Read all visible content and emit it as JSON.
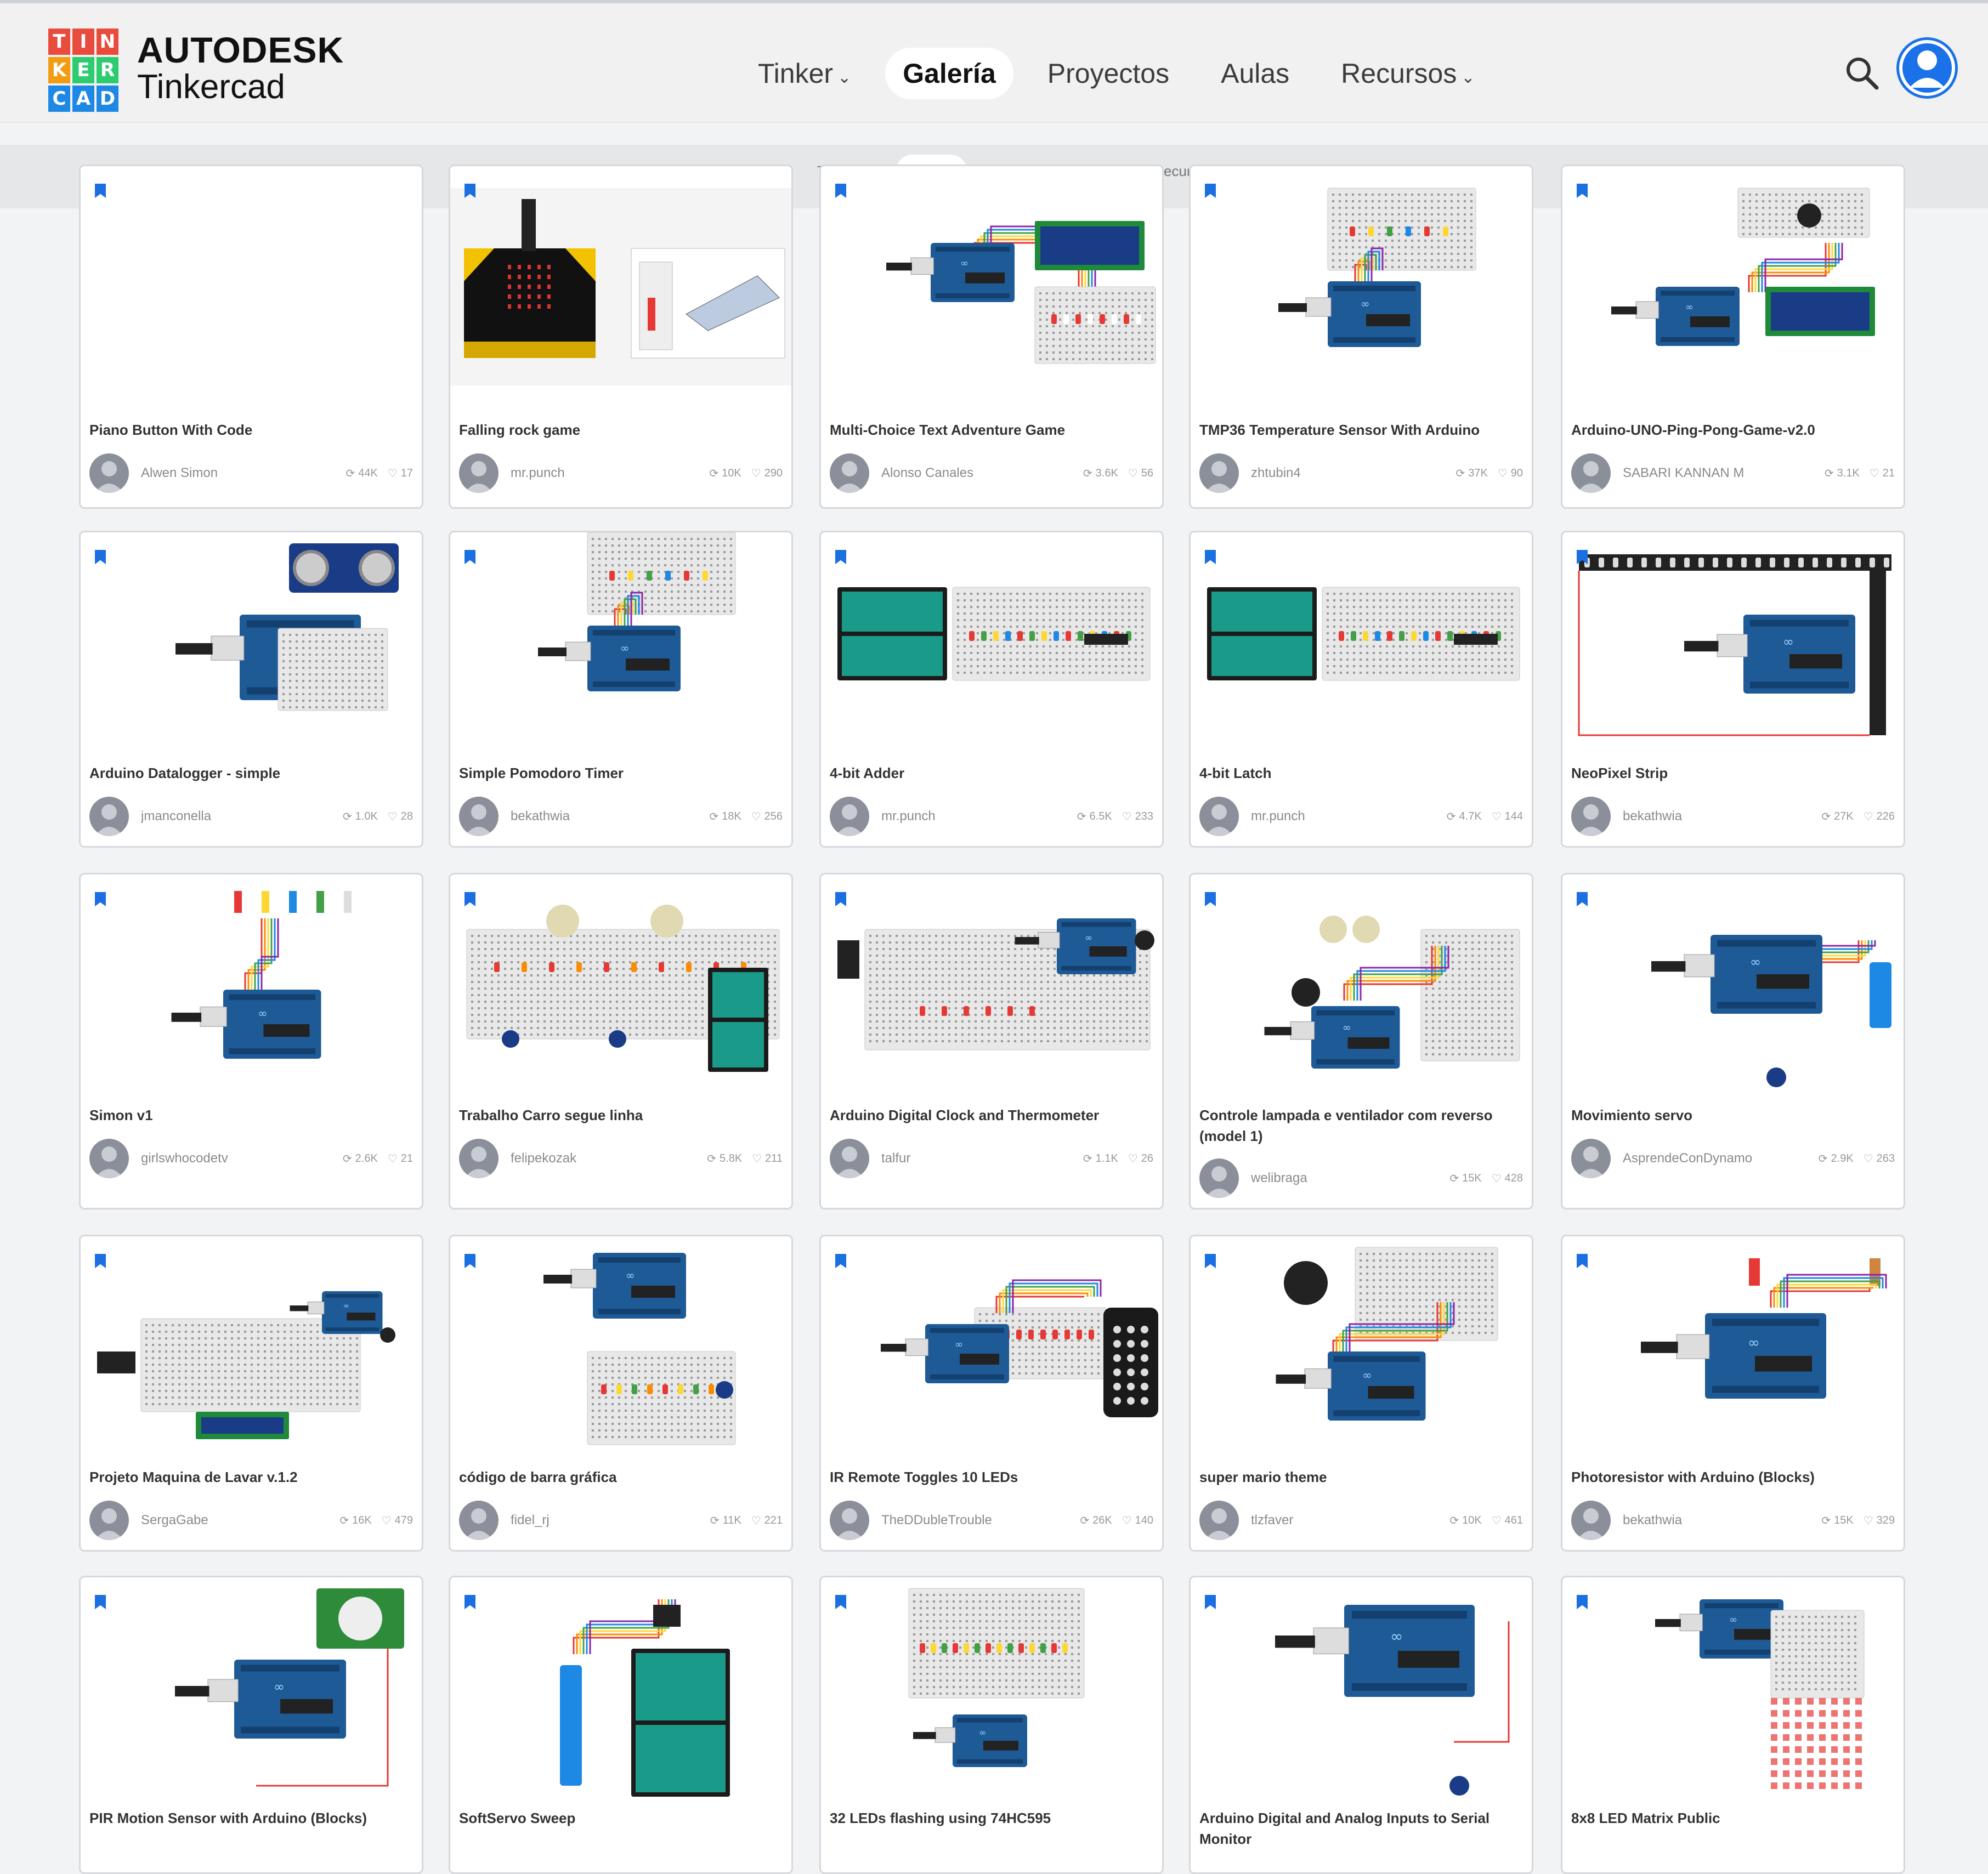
{
  "brand": {
    "logo_letters": [
      "T",
      "I",
      "N",
      "K",
      "E",
      "R",
      "C",
      "A",
      "D"
    ],
    "logo_colors": [
      "#e94b3c",
      "#e94b3c",
      "#e94b3c",
      "#f39c12",
      "#2ecc71",
      "#2ecc71",
      "#1e88e5",
      "#1e88e5",
      "#1e88e5"
    ],
    "line1": "AUTODESK",
    "line2": "Tinkercad"
  },
  "topnav": [
    {
      "label": "Tinker",
      "dropdown": true,
      "active": false
    },
    {
      "label": "Galería",
      "dropdown": false,
      "active": true
    },
    {
      "label": "Proyectos",
      "dropdown": false,
      "active": false
    },
    {
      "label": "Aulas",
      "dropdown": false,
      "active": false
    },
    {
      "label": "Recursos",
      "dropdown": true,
      "active": false
    }
  ],
  "subnav": [
    {
      "label": "Tinker",
      "dropdown": true,
      "active": false
    },
    {
      "label": "Galería",
      "dropdown": false,
      "active": true
    },
    {
      "label": "Proyectos",
      "dropdown": false,
      "active": false
    },
    {
      "label": "Aulas",
      "dropdown": false,
      "active": false
    },
    {
      "label": "Recursos",
      "dropdown": true,
      "active": false
    }
  ],
  "icons": {
    "search": "search-icon",
    "user": "user-avatar-icon",
    "bookmark": "bookmark-icon",
    "copy": "copy-icon",
    "like": "heart-icon"
  },
  "colors": {
    "accent": "#1b72e8",
    "arduino": "#1e5a96",
    "pcb_green": "#1f7a4d"
  },
  "cards": [
    {
      "title": "Piano Button With Code",
      "user": "Alwen Simon",
      "copies": "44K",
      "likes": "17",
      "thumb": "blank"
    },
    {
      "title": "Falling rock game",
      "user": "mr.punch",
      "copies": "10K",
      "likes": "290",
      "thumb": "microbit"
    },
    {
      "title": "Multi-Choice Text Adventure Game",
      "user": "Alonso Canales",
      "copies": "3.6K",
      "likes": "56",
      "thumb": "lcd"
    },
    {
      "title": "TMP36 Temperature Sensor With Arduino",
      "user": "zhtubin4",
      "copies": "37K",
      "likes": "90",
      "thumb": "breadboard-top"
    },
    {
      "title": "Arduino-UNO-Ping-Pong-Game-v2.0",
      "user": "SABARI KANNAN M",
      "copies": "3.1K",
      "likes": "21",
      "thumb": "lcd2"
    },
    {
      "title": "Arduino Datalogger - simple",
      "user": "jmanconella",
      "copies": "1.0K",
      "likes": "28",
      "thumb": "ultrasonic"
    },
    {
      "title": "Simple Pomodoro Timer",
      "user": "bekathwia",
      "copies": "18K",
      "likes": "256",
      "thumb": "breadboard-top"
    },
    {
      "title": "4-bit Adder",
      "user": "mr.punch",
      "copies": "6.5K",
      "likes": "233",
      "thumb": "battery-bb"
    },
    {
      "title": "4-bit Latch",
      "user": "mr.punch",
      "copies": "4.7K",
      "likes": "144",
      "thumb": "battery-bb"
    },
    {
      "title": "NeoPixel Strip",
      "user": "bekathwia",
      "copies": "27K",
      "likes": "226",
      "thumb": "neopixel"
    },
    {
      "title": "Simon v1",
      "user": "girlswhocodetv",
      "copies": "2.6K",
      "likes": "21",
      "thumb": "simon"
    },
    {
      "title": "Trabalho Carro segue linha",
      "user": "felipekozak",
      "copies": "5.8K",
      "likes": "211",
      "thumb": "car"
    },
    {
      "title": "Arduino Digital Clock and Thermometer",
      "user": "talfur",
      "copies": "1.1K",
      "likes": "26",
      "thumb": "clock"
    },
    {
      "title": "Controle lampada e ventilador com reverso (model 1)",
      "user": "welibraga",
      "copies": "15K",
      "likes": "428",
      "thumb": "fan"
    },
    {
      "title": "Movimiento servo",
      "user": "AsprendeConDynamo",
      "copies": "2.9K",
      "likes": "263",
      "thumb": "servo"
    },
    {
      "title": "Projeto Maquina de Lavar v.1.2",
      "user": "SergaGabe",
      "copies": "16K",
      "likes": "479",
      "thumb": "washer"
    },
    {
      "title": "código de barra gráfica",
      "user": "fidel_rj",
      "copies": "11K",
      "likes": "221",
      "thumb": "bargraph"
    },
    {
      "title": "IR Remote Toggles 10 LEDs",
      "user": "TheDDubleTrouble",
      "copies": "26K",
      "likes": "140",
      "thumb": "ir"
    },
    {
      "title": "super mario theme",
      "user": "tlzfaver",
      "copies": "10K",
      "likes": "461",
      "thumb": "mario"
    },
    {
      "title": "Photoresistor with Arduino (Blocks)",
      "user": "bekathwia",
      "copies": "15K",
      "likes": "329",
      "thumb": "photo"
    },
    {
      "title": "PIR Motion Sensor with Arduino (Blocks)",
      "user": "",
      "copies": "",
      "likes": "",
      "thumb": "pir"
    },
    {
      "title": "SoftServo Sweep",
      "user": "",
      "copies": "",
      "likes": "",
      "thumb": "softservo"
    },
    {
      "title": "32 LEDs flashing using 74HC595",
      "user": "",
      "copies": "",
      "likes": "",
      "thumb": "leds32"
    },
    {
      "title": "Arduino Digital and Analog Inputs to Serial Monitor",
      "user": "",
      "copies": "",
      "likes": "",
      "thumb": "inputs"
    },
    {
      "title": "8x8 LED Matrix Public",
      "user": "",
      "copies": "",
      "likes": "",
      "thumb": "matrix"
    }
  ]
}
